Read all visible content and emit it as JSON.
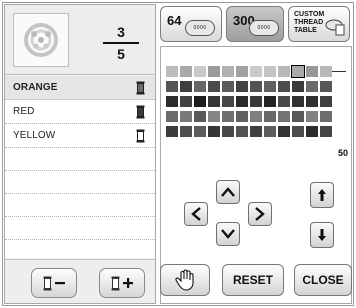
{
  "selection": {
    "current": "3",
    "total": "5"
  },
  "thread_list": [
    {
      "name": "ORANGE",
      "selected": true
    },
    {
      "name": "RED",
      "selected": false
    },
    {
      "name": "YELLOW",
      "selected": false
    }
  ],
  "palette_tabs": {
    "tab64": "64",
    "tab300": "300",
    "spool_text": "0000",
    "custom_line1": "CUSTOM",
    "custom_line2": "THREAD",
    "custom_line3": "TABLE"
  },
  "palette": {
    "page_number": "50",
    "selected_cell": {
      "row": 0,
      "col": 9
    },
    "rows": [
      [
        "#bcbcbc",
        "#a8a8a8",
        "#c8c8c8",
        "#9b9b9b",
        "#b1b1b1",
        "#a1a1a1",
        "#cacaca",
        "#c4c4c4",
        "#b8b8b8",
        "#aaaaaa",
        "#989898",
        "#b9b9b9"
      ],
      [
        "#555555",
        "#3f3f3f",
        "#676767",
        "#4b4b4b",
        "#5c5c5c",
        "#434343",
        "#535353",
        "#5f5f5f",
        "#4d4d4d",
        "#3b3b3b",
        "#6b6b6b",
        "#575757"
      ],
      [
        "#2d2d2d",
        "#424242",
        "#1e1e1e",
        "#363636",
        "#464646",
        "#2a2a2a",
        "#3a3a3a",
        "#232323",
        "#4a4a4a",
        "#313131",
        "#2f2f2f",
        "#3f3f3f"
      ],
      [
        "#6a6a6a",
        "#7a7a7a",
        "#5a5a5a",
        "#858585",
        "#6f6f6f",
        "#616161",
        "#7e7e7e",
        "#696969",
        "#747474",
        "#595959",
        "#818181",
        "#6c6c6c"
      ],
      [
        "#3c3c3c",
        "#4f4f4f",
        "#5b5b5b",
        "#353535",
        "#484848",
        "#525252",
        "#404040",
        "#5d5d5d",
        "#333333",
        "#4c4c4c",
        "#2c2c2c",
        "#444444"
      ]
    ]
  },
  "buttons": {
    "reset": "RESET",
    "close": "CLOSE"
  }
}
